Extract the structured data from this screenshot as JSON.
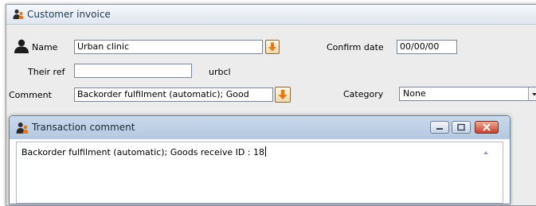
{
  "window": {
    "title": "Customer invoice",
    "icon": "people-icon"
  },
  "form": {
    "name_label": "Name",
    "name_value": "Urban clinic",
    "their_ref_label": "Their ref",
    "their_ref_value": "",
    "customer_code": "urbcl",
    "comment_label": "Comment",
    "comment_value": "Backorder fulfilment (automatic);  Good",
    "confirm_date_label": "Confirm date",
    "confirm_date_value": "00/00/00",
    "category_label": "Category",
    "category_value": "None"
  },
  "dialog": {
    "title": "Transaction comment",
    "text": "Backorder fulfilment (automatic);  Goods receive ID : 18",
    "buttons": [
      "minimize",
      "maximize",
      "close"
    ]
  },
  "colors": {
    "arrow_button": "#e27a1a",
    "dialog_title": "#b9cde4",
    "close_button": "#c8412d"
  }
}
